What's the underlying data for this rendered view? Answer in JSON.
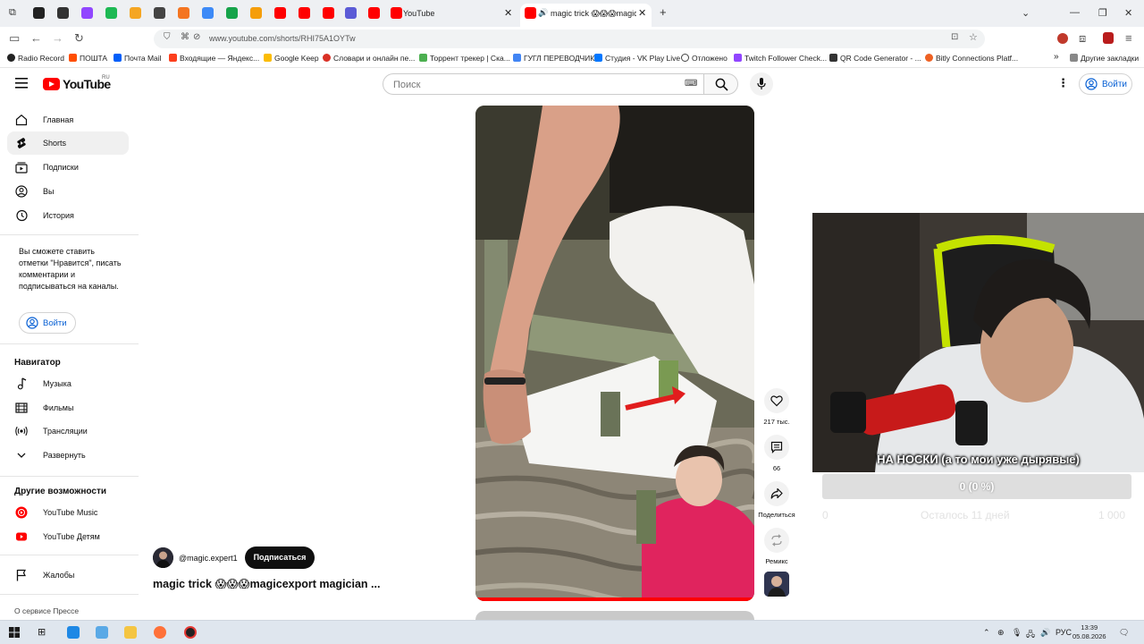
{
  "browser": {
    "tabs": [
      {
        "label": "YouTube",
        "favicon_color": "#ff0000"
      },
      {
        "label": "magic trick 😱😱😱magic",
        "favicon_color": "#ff0000",
        "active": true
      }
    ],
    "new_tab_symbol": "+",
    "url": "www.youtube.com/shorts/RHI75A1OYTw",
    "bookmarks": [
      {
        "label": "Radio Record",
        "color": "#222222"
      },
      {
        "label": "ПОШТА",
        "color": "#ff4e00"
      },
      {
        "label": "Почта Mail",
        "color": "#005ff9"
      },
      {
        "label": "Входящие — Яндекс...",
        "color": "#fc3f1d"
      },
      {
        "label": "Google Keep",
        "color": "#fbbc04"
      },
      {
        "label": "Словари и онлайн пе...",
        "color": "#d93025"
      },
      {
        "label": "Торрент трекер | Ска...",
        "color": "#4caf50"
      },
      {
        "label": "ГУГЛ ПЕРЕВОДЧИК",
        "color": "#4285f4"
      },
      {
        "label": "Студия - VK Play Live",
        "color": "#0077ff"
      },
      {
        "label": "Отложено",
        "color": "#444444"
      },
      {
        "label": "Twitch Follower Check...",
        "color": "#9146ff"
      },
      {
        "label": "QR Code Generator - ...",
        "color": "#333333"
      },
      {
        "label": "Bitly Connections Platf...",
        "color": "#ee6123"
      }
    ],
    "other_bookmarks": "Другие закладки"
  },
  "youtube": {
    "logo": "YouTube",
    "logo_region": "RU",
    "search_placeholder": "Поиск",
    "signin": "Войти",
    "sidebar": {
      "main": [
        {
          "label": "Главная",
          "icon": "home-icon"
        },
        {
          "label": "Shorts",
          "icon": "shorts-icon",
          "active": true
        },
        {
          "label": "Подписки",
          "icon": "subscriptions-icon"
        },
        {
          "label": "Вы",
          "icon": "you-icon"
        },
        {
          "label": "История",
          "icon": "history-icon"
        }
      ],
      "signin_note": "Вы сможете ставить отметки \"Нравится\", писать комментарии и подписываться на каналы.",
      "signin_button": "Войти",
      "navigator_heading": "Навигатор",
      "navigator": [
        {
          "label": "Музыка",
          "icon": "music-icon"
        },
        {
          "label": "Фильмы",
          "icon": "movies-icon"
        },
        {
          "label": "Трансляции",
          "icon": "live-icon"
        },
        {
          "label": "Развернуть",
          "icon": "chevron-down-icon"
        }
      ],
      "more_heading": "Другие возможности",
      "more": [
        {
          "label": "YouTube Music",
          "icon": "youtube-music-icon"
        },
        {
          "label": "YouTube Детям",
          "icon": "youtube-kids-icon"
        }
      ],
      "reports": "Жалобы",
      "footer": "О сервисе  Прессе"
    },
    "short": {
      "channel": "@magic.expert1",
      "subscribe": "Подписаться",
      "title": "magic trick 😱😱😱magicexport magician ...",
      "likes": "217 тыс.",
      "comments": "66",
      "share": "Поделиться",
      "remix": "Ремикс"
    }
  },
  "stream_overlay": {
    "caption": "НА НОСКИ (а то мои уже дырявые)",
    "goal_progress_text": "0 (0 %)",
    "goal_percent": 0,
    "goal_min": "0",
    "goal_remaining": "Осталось 11 дней",
    "goal_max": "1 000"
  },
  "taskbar": {
    "language": "РУС",
    "time": "13:39",
    "date": "05.08.2026"
  }
}
